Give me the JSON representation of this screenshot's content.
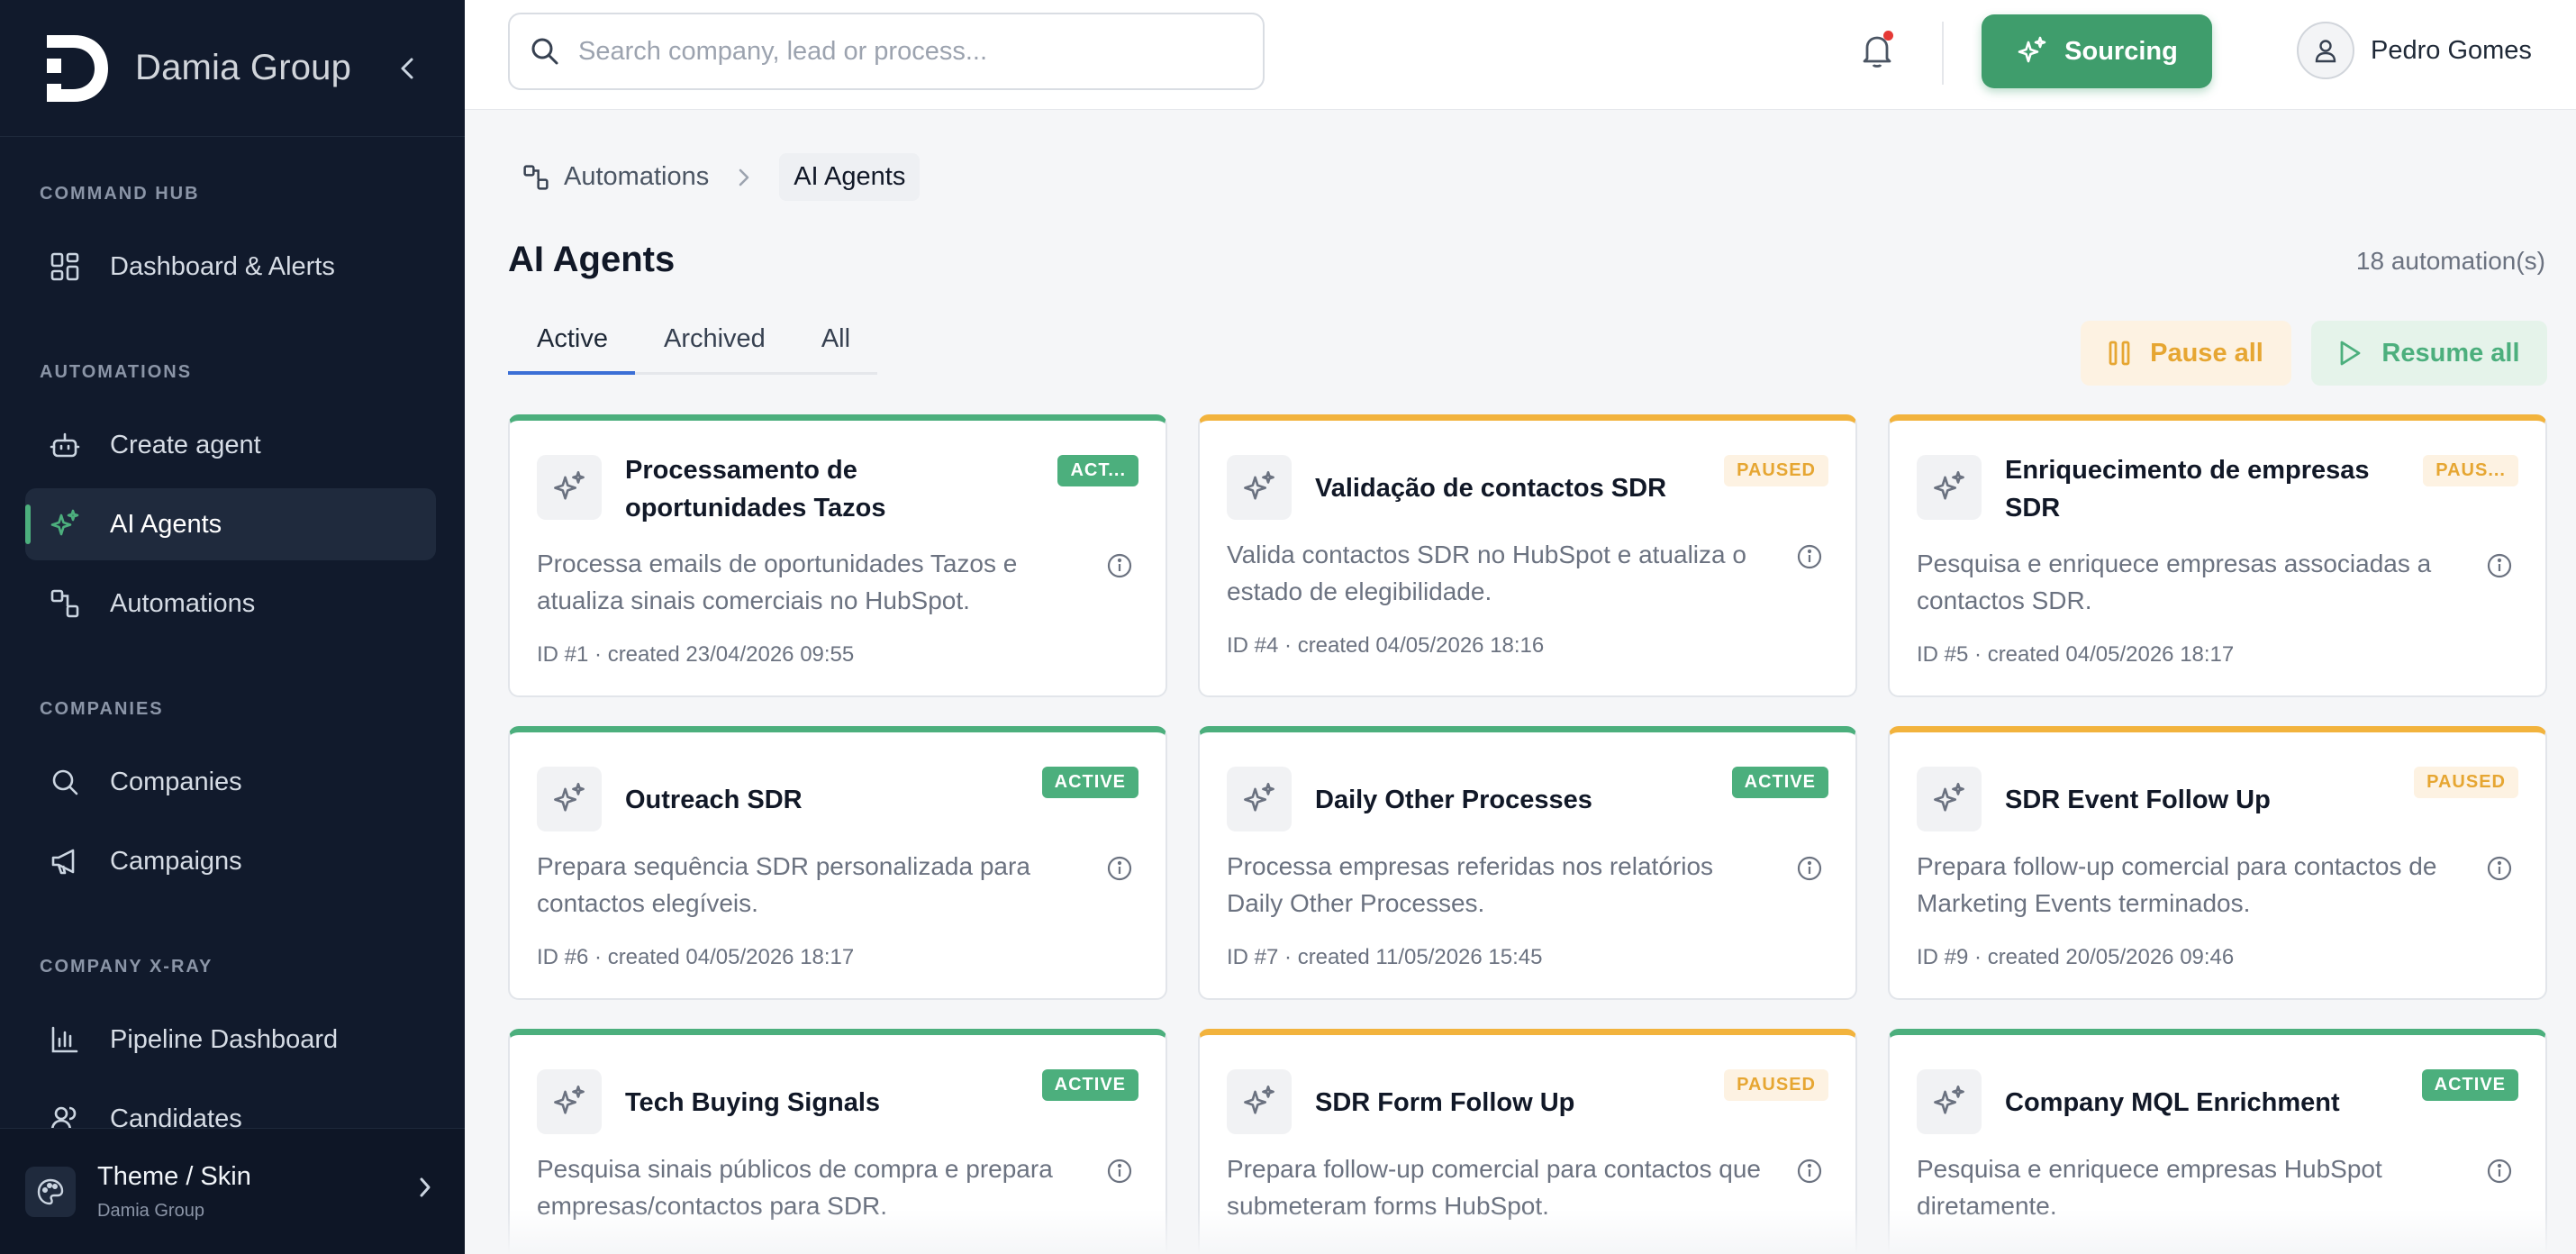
{
  "brand": {
    "name": "Damia Group"
  },
  "sidebar": {
    "sections": [
      {
        "title": "COMMAND HUB"
      },
      {
        "title": "AUTOMATIONS"
      },
      {
        "title": "COMPANIES"
      },
      {
        "title": "COMPANY X-RAY"
      }
    ],
    "items": [
      {
        "label": "Dashboard & Alerts",
        "icon": "dashboard-icon"
      },
      {
        "label": "Create agent",
        "icon": "robot-icon"
      },
      {
        "label": "AI Agents",
        "icon": "sparkles-icon",
        "active": true
      },
      {
        "label": "Automations",
        "icon": "workflow-icon"
      },
      {
        "label": "Companies",
        "icon": "search-icon"
      },
      {
        "label": "Campaigns",
        "icon": "megaphone-icon"
      },
      {
        "label": "Pipeline Dashboard",
        "icon": "bar-chart-icon"
      },
      {
        "label": "Candidates",
        "icon": "users-icon"
      }
    ],
    "footer": {
      "title": "Theme / Skin",
      "subtitle": "Damia Group"
    }
  },
  "topbar": {
    "search_placeholder": "Search company, lead or process...",
    "sourcing_label": "Sourcing",
    "user_name": "Pedro Gomes"
  },
  "breadcrumb": {
    "parent": "Automations",
    "current": "AI Agents"
  },
  "page": {
    "title": "AI Agents",
    "count": "18 automation(s)",
    "tabs": [
      "Active",
      "Archived",
      "All"
    ],
    "active_tab": "Active",
    "pause_all": "Pause all",
    "resume_all": "Resume all"
  },
  "colors": {
    "active": "#4caf7d",
    "paused": "#f2b33d",
    "sidebar_bg": "#111a2c",
    "accent_blue": "#3b6fd6"
  },
  "cards": [
    {
      "title": "Processamento de oportunidades Tazos",
      "status": "active",
      "badge": "ACT...",
      "description": "Processa emails de oportunidades Tazos e atualiza sinais comerciais no HubSpot.",
      "meta": "ID #1 · created 23/04/2026 09:55"
    },
    {
      "title": "Validação de contactos SDR",
      "status": "paused",
      "badge": "PAUSED",
      "description": "Valida contactos SDR no HubSpot e atualiza o estado de elegibilidade.",
      "meta": "ID #4 · created 04/05/2026 18:16"
    },
    {
      "title": "Enriquecimento de empresas SDR",
      "status": "paused",
      "badge": "PAUS...",
      "description": "Pesquisa e enriquece empresas associadas a contactos SDR.",
      "meta": "ID #5 · created 04/05/2026 18:17"
    },
    {
      "title": "Outreach SDR",
      "status": "active",
      "badge": "ACTIVE",
      "description": "Prepara sequência SDR personalizada para contactos elegíveis.",
      "meta": "ID #6 · created 04/05/2026 18:17"
    },
    {
      "title": "Daily Other Processes",
      "status": "active",
      "badge": "ACTIVE",
      "description": "Processa empresas referidas nos relatórios Daily Other Processes.",
      "meta": "ID #7 · created 11/05/2026 15:45"
    },
    {
      "title": "SDR Event Follow Up",
      "status": "paused",
      "badge": "PAUSED",
      "description": "Prepara follow-up comercial para contactos de Marketing Events terminados.",
      "meta": "ID #9 · created 20/05/2026 09:46"
    },
    {
      "title": "Tech Buying Signals",
      "status": "active",
      "badge": "ACTIVE",
      "description": "Pesquisa sinais públicos de compra e prepara empresas/contactos para SDR.",
      "meta": ""
    },
    {
      "title": "SDR Form Follow Up",
      "status": "paused",
      "badge": "PAUSED",
      "description": "Prepara follow-up comercial para contactos que submeteram forms HubSpot.",
      "meta": ""
    },
    {
      "title": "Company MQL Enrichment",
      "status": "active",
      "badge": "ACTIVE",
      "description": "Pesquisa e enriquece empresas HubSpot diretamente.",
      "meta": ""
    }
  ]
}
